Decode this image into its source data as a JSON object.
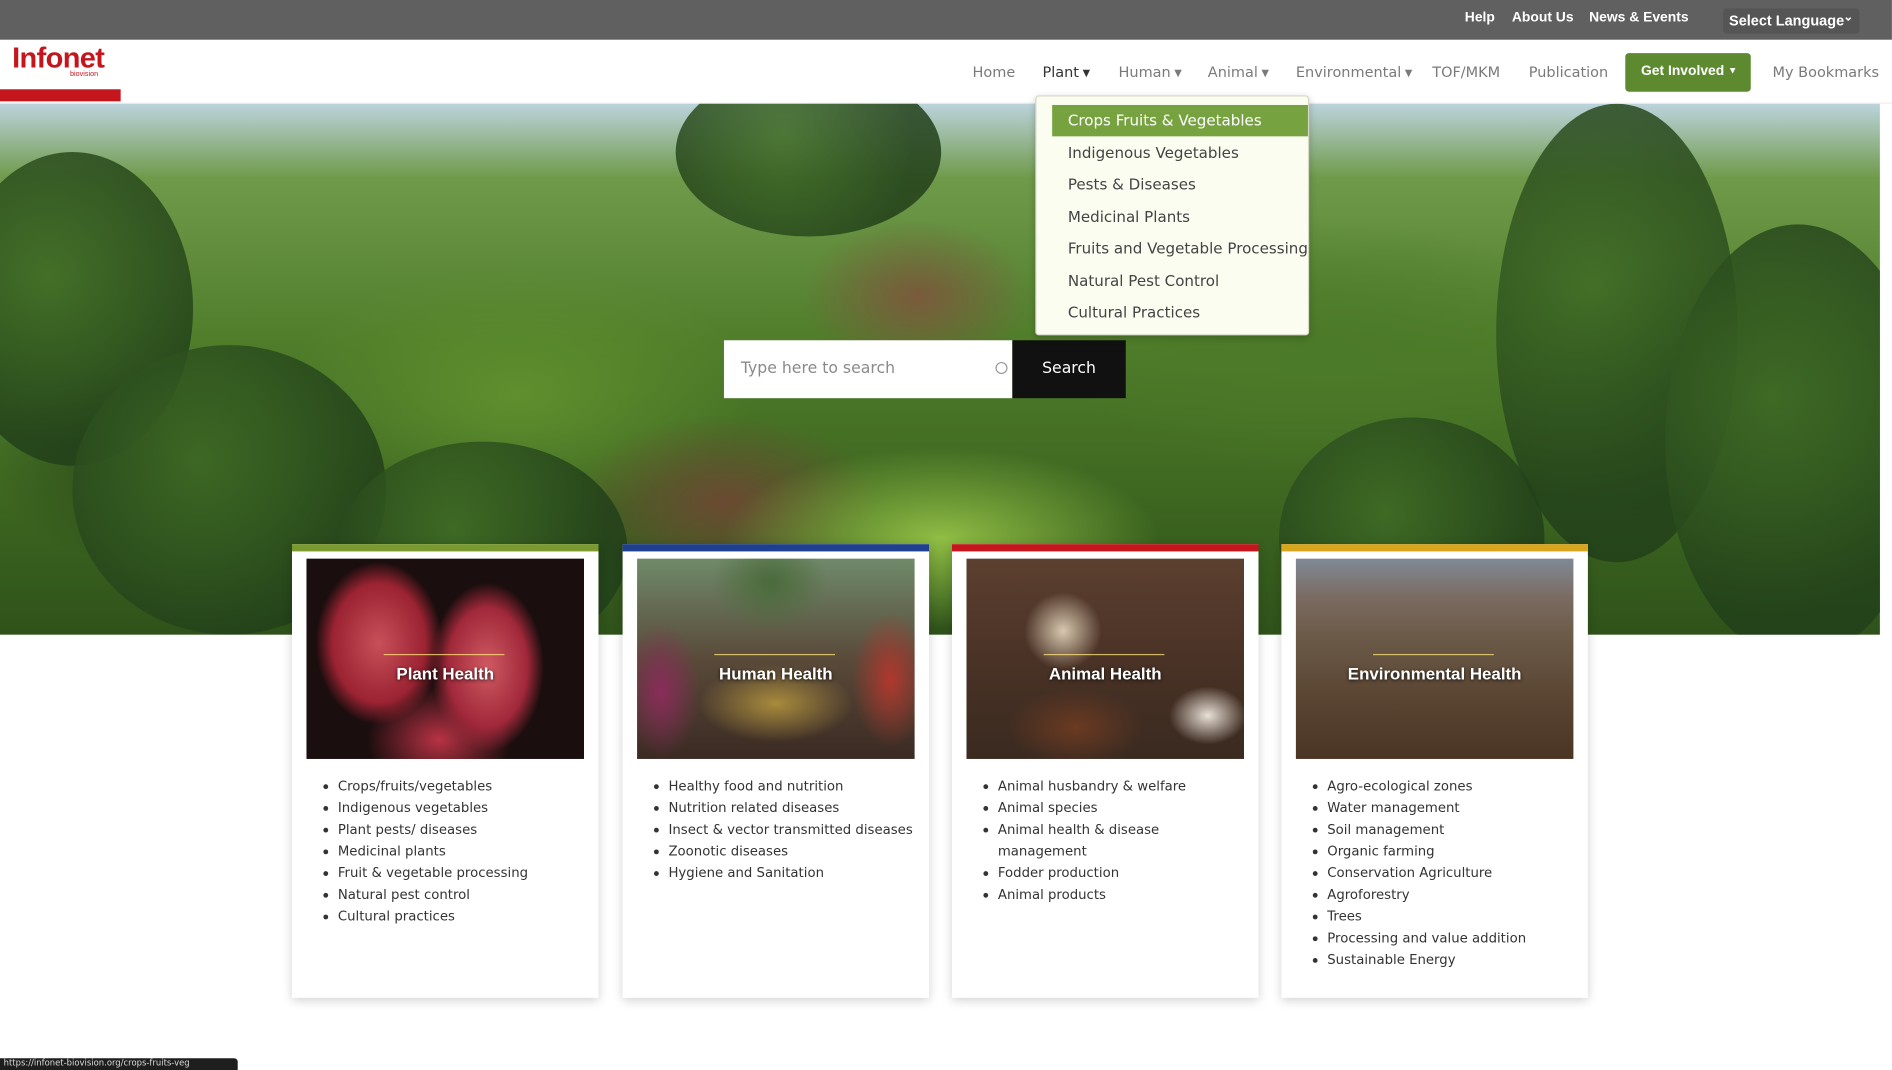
{
  "topbar": {
    "links": [
      "Help",
      "About Us",
      "News & Events"
    ],
    "language": "Select Language"
  },
  "logo": {
    "text": "Infonet",
    "sub": "biovision"
  },
  "nav": {
    "items": [
      "Home",
      "Plant",
      "Human",
      "Animal",
      "Environmental",
      "TOF/MKM",
      "Publication"
    ],
    "get_involved": "Get Involved",
    "bookmarks": "My Bookmarks"
  },
  "dropdown": {
    "items": [
      "Crops Fruits & Vegetables",
      "Indigenous Vegetables",
      "Pests & Diseases",
      "Medicinal Plants",
      "Fruits and Vegetable Processing",
      "Natural Pest Control",
      "Cultural Practices"
    ]
  },
  "search": {
    "placeholder": "Type here to search",
    "button": "Search"
  },
  "cards": [
    {
      "title": "Plant Health",
      "accent": "#7a9a2f",
      "items": [
        "Crops/fruits/vegetables",
        "Indigenous vegetables",
        "Plant pests/ diseases",
        "Medicinal plants",
        "Fruit & vegetable processing",
        "Natural pest control",
        "Cultural practices"
      ]
    },
    {
      "title": "Human Health",
      "accent": "#1f3f8f",
      "items": [
        "Healthy food and nutrition",
        "Nutrition related diseases",
        "Insect & vector transmitted diseases",
        "Zoonotic diseases",
        "Hygiene and Sanitation"
      ]
    },
    {
      "title": "Animal Health",
      "accent": "#c4161c",
      "items": [
        "Animal husbandry & welfare",
        "Animal species",
        "Animal health & disease management",
        "Fodder production",
        "Animal products"
      ]
    },
    {
      "title": "Environmental Health",
      "accent": "#d8a51f",
      "items": [
        "Agro-ecological zones",
        "Water management",
        "Soil management",
        "Organic farming",
        "Conservation Agriculture",
        "Agroforestry",
        "Trees",
        "Processing and value addition",
        "Sustainable Energy"
      ]
    }
  ],
  "status_url": "https://infonet-biovision.org/crops-fruits-veg"
}
